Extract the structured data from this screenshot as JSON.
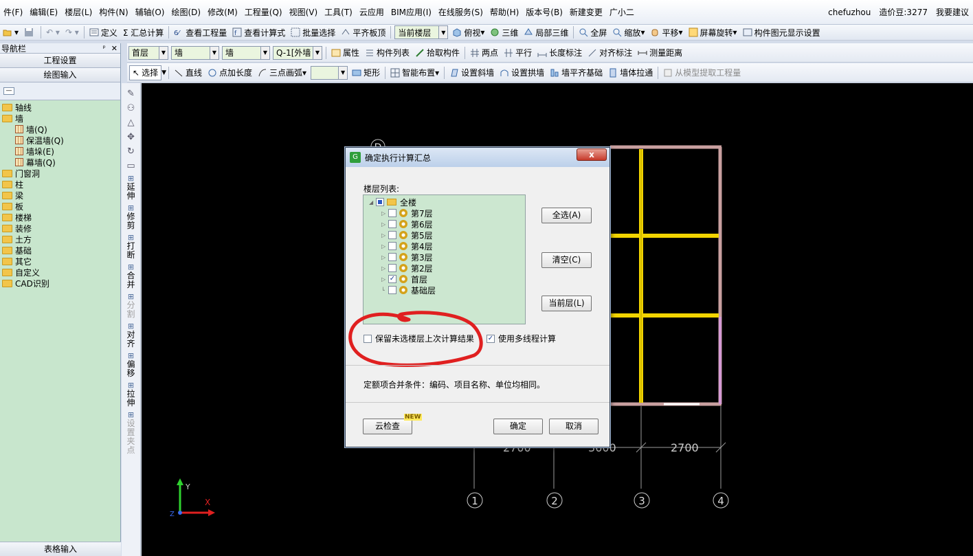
{
  "menu": {
    "items": [
      "件(F)",
      "编辑(E)",
      "楼层(L)",
      "构件(N)",
      "辅轴(O)",
      "绘图(D)",
      "修改(M)",
      "工程量(Q)",
      "视图(V)",
      "工具(T)",
      "云应用",
      "BIM应用(I)",
      "在线服务(S)",
      "帮助(H)",
      "版本号(B)",
      "新建变更",
      "广小二"
    ],
    "user": "chefuzhou",
    "cost_beans": "造价豆:3277",
    "suggest": "我要建议"
  },
  "toolbar1": {
    "define": "定义",
    "sum_calc": "Σ 汇总计算",
    "view_quantity": "查看工程量",
    "view_formula": "查看计算式",
    "batch_select": "批量选择",
    "align_slab": "平齐板顶",
    "current_floor": "当前楼层",
    "top_view": "俯视",
    "threed": "三维",
    "local_3d": "局部三维",
    "fullscreen": "全屏",
    "zoom": "缩放",
    "pan": "平移",
    "rotate": "屏幕旋转",
    "element_display": "构件图元显示设置"
  },
  "toolbar2": {
    "floor_combo": "首层",
    "type_combo1": "墙",
    "type_combo2": "墙",
    "element_combo": "Q-1[外墙",
    "properties": "属性",
    "element_list": "构件列表",
    "pick_element": "拾取构件",
    "two_points": "两点",
    "parallel": "平行",
    "length_dim": "长度标注",
    "align_dim": "对齐标注",
    "measure": "测量距离"
  },
  "toolbar3": {
    "select": "选择",
    "line": "直线",
    "point_length": "点加长度",
    "three_point_arc": "三点画弧",
    "rect": "矩形",
    "smart_layout": "智能布置",
    "slope_wall": "设置斜墙",
    "arch_wall": "设置拱墙",
    "wall_flush": "墙平齐基础",
    "wall_pull": "墙体拉通",
    "extract": "从模型提取工程量"
  },
  "nav": {
    "title": "导航栏",
    "project_settings": "工程设置",
    "drawing_input": "绘图输入",
    "table_input": "表格输入",
    "tree": [
      {
        "label": "轴线",
        "level": 0
      },
      {
        "label": "墙",
        "level": 0
      },
      {
        "label": "墙(Q)",
        "level": 1
      },
      {
        "label": "保温墙(Q)",
        "level": 1
      },
      {
        "label": "墙垛(E)",
        "level": 1
      },
      {
        "label": "幕墙(Q)",
        "level": 1
      },
      {
        "label": "门窗洞",
        "level": 0
      },
      {
        "label": "柱",
        "level": 0
      },
      {
        "label": "梁",
        "level": 0
      },
      {
        "label": "板",
        "level": 0
      },
      {
        "label": "楼梯",
        "level": 0
      },
      {
        "label": "装修",
        "level": 0
      },
      {
        "label": "土方",
        "level": 0
      },
      {
        "label": "基础",
        "level": 0
      },
      {
        "label": "其它",
        "level": 0
      },
      {
        "label": "自定义",
        "level": 0
      },
      {
        "label": "CAD识别",
        "level": 0
      }
    ]
  },
  "vtools": [
    "延伸",
    "修剪",
    "打断",
    "合并",
    "分割",
    "对齐",
    "偏移",
    "拉伸",
    "设置夹点"
  ],
  "canvas": {
    "dims": [
      "2700",
      "3600",
      "2700"
    ],
    "axes": [
      "1",
      "2",
      "3",
      "4"
    ],
    "axis_y": "Y",
    "axis_x": "X",
    "axis_z": "Z",
    "grid_d": "D"
  },
  "dialog": {
    "title": "确定执行计算汇总",
    "floor_list_label": "楼层列表:",
    "floors": [
      {
        "label": "全楼",
        "checked": "partial",
        "root": true
      },
      {
        "label": "第7层",
        "checked": false
      },
      {
        "label": "第6层",
        "checked": false
      },
      {
        "label": "第5层",
        "checked": false
      },
      {
        "label": "第4层",
        "checked": false
      },
      {
        "label": "第3层",
        "checked": false
      },
      {
        "label": "第2层",
        "checked": false
      },
      {
        "label": "首层",
        "checked": true
      },
      {
        "label": "基础层",
        "checked": false
      }
    ],
    "select_all": "全选(A)",
    "clear": "清空(C)",
    "current_floor": "当前层(L)",
    "keep_unselected": "保留未选楼层上次计算结果",
    "keep_unselected_checked": false,
    "multithread": "使用多线程计算",
    "multithread_checked": true,
    "merge_note": "定额项合并条件：编码、项目名称、单位均相同。",
    "cloud_check": "云检查",
    "new_badge": "NEW",
    "ok": "确定",
    "cancel": "取消",
    "close": "x"
  }
}
